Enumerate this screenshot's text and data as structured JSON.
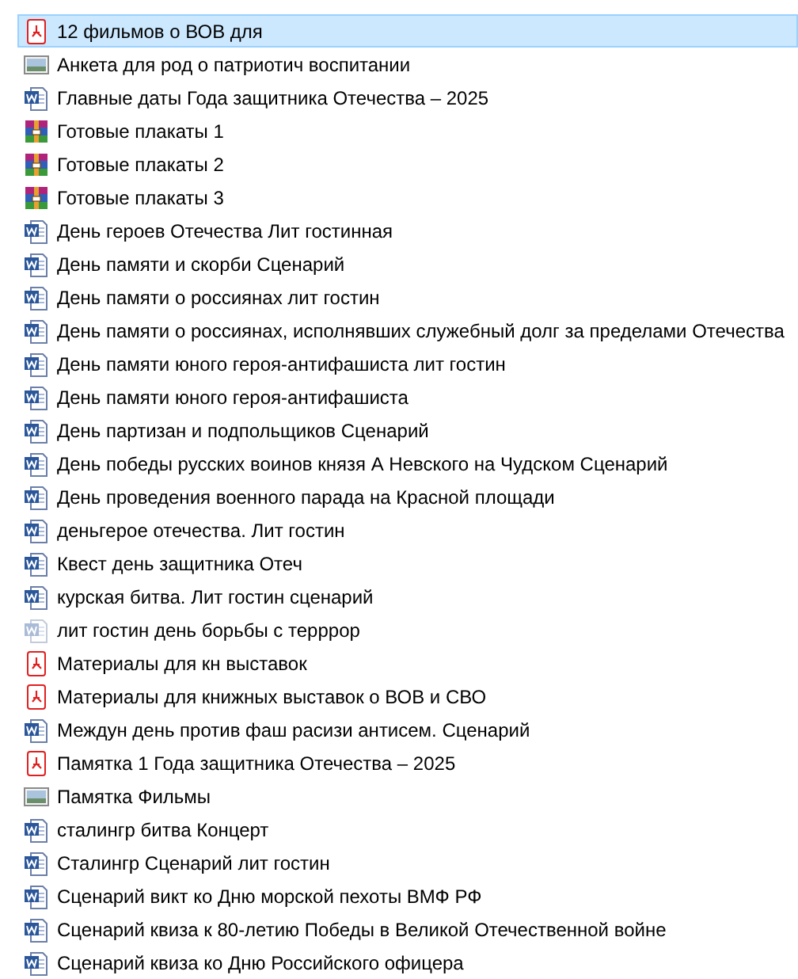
{
  "files": [
    {
      "name": "12 фильмов о ВОВ для",
      "kind": "pdf",
      "selected": true
    },
    {
      "name": "Анкета для род о патриотич воспитании",
      "kind": "image",
      "selected": false
    },
    {
      "name": "Главные даты Года защитника Отечества – 2025",
      "kind": "word",
      "selected": false
    },
    {
      "name": "Готовые плакаты 1",
      "kind": "archive",
      "selected": false
    },
    {
      "name": "Готовые плакаты 2",
      "kind": "archive",
      "selected": false
    },
    {
      "name": "Готовые плакаты 3",
      "kind": "archive",
      "selected": false
    },
    {
      "name": "День героев Отечества Лит гостинная",
      "kind": "word",
      "selected": false
    },
    {
      "name": "День памяти и скорби Сценарий",
      "kind": "word",
      "selected": false
    },
    {
      "name": "День памяти о россиянах лит гостин",
      "kind": "word",
      "selected": false
    },
    {
      "name": "День памяти о россиянах, исполнявших служебный долг за пределами Отечества",
      "kind": "word",
      "selected": false
    },
    {
      "name": "День памяти юного героя-антифашиста лит гостин",
      "kind": "word",
      "selected": false
    },
    {
      "name": "День памяти юного героя-антифашиста",
      "kind": "word",
      "selected": false
    },
    {
      "name": "День партизан и подпольщиков Сценарий",
      "kind": "word",
      "selected": false
    },
    {
      "name": "День победы русских воинов князя А Невского  на Чудском  Сценарий",
      "kind": "word",
      "selected": false
    },
    {
      "name": "День проведения военного парада на Красной площади",
      "kind": "word",
      "selected": false
    },
    {
      "name": "деньгерое отечества. Лит гостин",
      "kind": "word",
      "selected": false
    },
    {
      "name": "Квест день защитника Отеч",
      "kind": "word",
      "selected": false
    },
    {
      "name": "курская битва. Лит гостин сценарий",
      "kind": "word",
      "selected": false
    },
    {
      "name": "лит гостин день борьбы с терррор",
      "kind": "word-faded",
      "selected": false
    },
    {
      "name": "Материалы для кн выставок",
      "kind": "pdf",
      "selected": false
    },
    {
      "name": "Материалы для книжных выставок о ВОВ и СВО",
      "kind": "pdf",
      "selected": false
    },
    {
      "name": "Междун день против фаш расизи антисем. Сценарий",
      "kind": "word",
      "selected": false
    },
    {
      "name": "Памятка 1 Года защитника Отечества – 2025",
      "kind": "pdf",
      "selected": false
    },
    {
      "name": "Памятка Фильмы",
      "kind": "image",
      "selected": false
    },
    {
      "name": "сталингр битва Концерт",
      "kind": "word",
      "selected": false
    },
    {
      "name": "Сталингр Сценарий лит гостин",
      "kind": "word",
      "selected": false
    },
    {
      "name": "Сценарий викт ко Дню морской пехоты ВМФ РФ",
      "kind": "word",
      "selected": false
    },
    {
      "name": "Сценарий квиза к 80-летию Победы в Великой Отечественной войне",
      "kind": "word",
      "selected": false
    },
    {
      "name": "Сценарий квиза ко Дню Российского офицера",
      "kind": "word",
      "selected": false
    }
  ]
}
